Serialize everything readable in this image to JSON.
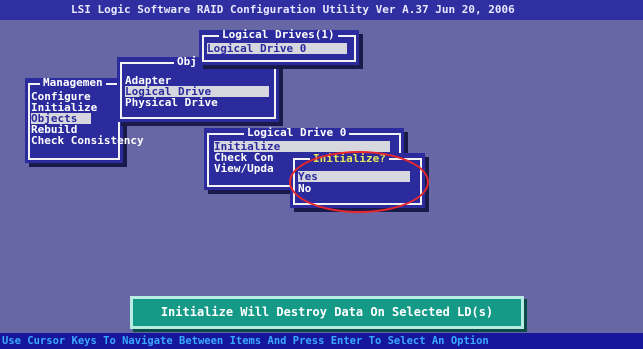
{
  "title_bar": "LSI Logic Software RAID Configuration Utility Ver A.37 Jun 20, 2006",
  "management_menu": {
    "title": "Managemen",
    "items": [
      "Configure",
      "Initialize",
      "Objects",
      "Rebuild",
      "Check Consistency"
    ],
    "selected": "Objects"
  },
  "objects_menu": {
    "title": "Obj",
    "items": [
      "Adapter",
      "Logical Drive",
      "Physical Drive"
    ],
    "selected": "Logical Drive"
  },
  "logical_drives_menu": {
    "title": "Logical Drives(1)",
    "items": [
      "Logical Drive 0"
    ],
    "selected": "Logical Drive 0"
  },
  "logical_drive_menu": {
    "title": "Logical Drive 0",
    "items": [
      "Initialize",
      "Check Con",
      "View/Upda"
    ],
    "selected": "Initialize"
  },
  "initialize_dialog": {
    "title": "Initialize?",
    "options": [
      "Yes",
      "No"
    ],
    "selected": "Yes"
  },
  "notice": "Initialize Will Destroy Data On Selected LD(s)",
  "status_bar": "Use Cursor Keys To Navigate Between Items And Press Enter To Select An Option",
  "colors": {
    "background": "#6767a5",
    "window": "#2b2b9e",
    "highlight": "#d7d7e0",
    "notice": "#169a88",
    "annotation": "#e8262b"
  }
}
